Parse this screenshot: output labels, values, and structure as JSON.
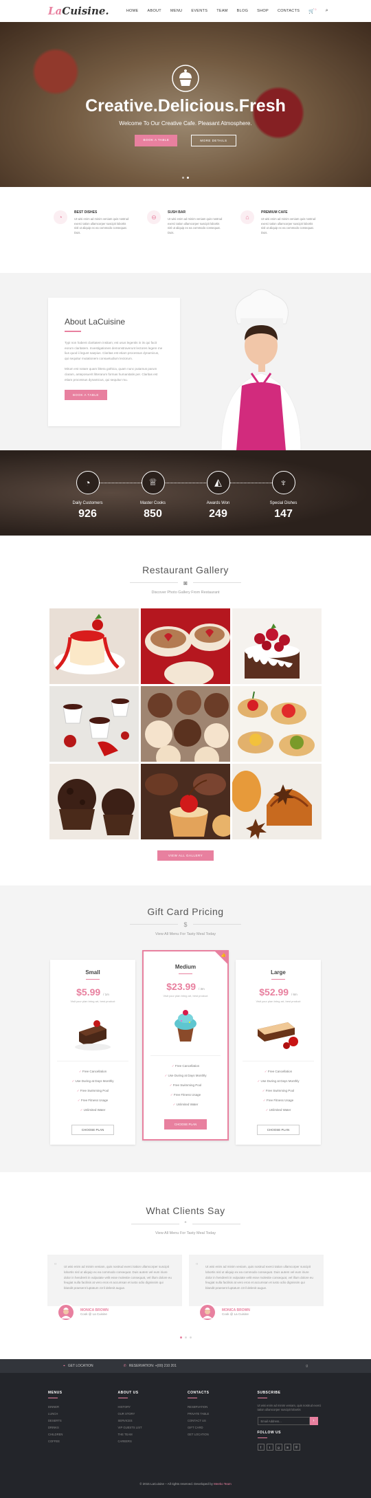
{
  "nav": {
    "logo_first": "La",
    "logo_rest": "Cuisine",
    "logo_dot": ".",
    "items": [
      "HOME",
      "ABOUT",
      "MENU",
      "EVENTS",
      "TEAM",
      "BLOG",
      "SHOP",
      "CONTACTS"
    ],
    "cart_count": "0"
  },
  "hero": {
    "title": "Creative.Delicious.Fresh",
    "subtitle": "Welcome To Our Creative Cafe. Pleasant Atmosphere.",
    "btn_primary": "BOOK A TABLE",
    "btn_secondary": "MORE DETAILS"
  },
  "features": [
    {
      "title": "BEST DISHES",
      "icon": "fish-icon",
      "text": "Ut wisi enim ad minim veniam quis nostrud exerci tation ullamcorper suscipit lobortis nisl ut aliquip ex ea commodo consequat. Duis."
    },
    {
      "title": "SUSH BAR",
      "icon": "sushi-icon",
      "text": "Ut wisi enim ad minim veniam quis nostrud exerci tation ullamcorper suscipit lobortis nisl ut aliquip ex ea commodo consequat. Duis."
    },
    {
      "title": "PREMIUM CAFE",
      "icon": "cake-icon",
      "text": "Ut wisi enim ad minim veniam quis nostrud exerci tation ullamcorper suscipit lobortis nisl ut aliquip ex ea commodo consequat. Duis."
    }
  ],
  "about": {
    "title": "About LaCuisine",
    "p1": "Typi non habent claritatem insitam; est usus legentis in iis qui facit eorum claritatem. Investigationes demonstraverunt lectores legere me lius quod ii legunt saepius. Claritas est etiam processus dynamicus, qui sequitur mutationem consuetudium lectorum.",
    "p2": "Mirum est notare quam littera gothica, quam nunc putamus parum claram, anteposuerit litterarum formas humanitatis per. Claritas est etiam processus dynamicus, qui sequitur mu.",
    "button": "BOOK A TABLE"
  },
  "counters": [
    {
      "label": "Daily Customers",
      "value": "926",
      "icon": "fish-icon",
      "glyph": "🐟"
    },
    {
      "label": "Master Cooks",
      "value": "850",
      "icon": "chef-hat-icon",
      "glyph": "👨‍🍳"
    },
    {
      "label": "Awards Won",
      "value": "249",
      "icon": "cheese-icon",
      "glyph": "🧀"
    },
    {
      "label": "Special Dishes",
      "value": "147",
      "icon": "wine-glass-icon",
      "glyph": "🍷"
    }
  ],
  "gallery": {
    "title": "Restaurant Gallery",
    "subtitle": "Discover Photo Gallery From Restaurant",
    "button": "VIEW ALL GALLERY"
  },
  "pricing": {
    "title": "Gift Card Pricing",
    "icon": "$",
    "subtitle": "View All Menu For Tasty Meal Today",
    "plans": [
      {
        "name": "Small",
        "price": "$5.99",
        "per": "/ 1m",
        "desc": "Visit your plan bring art, best product",
        "features": [
          "Free Cancellation",
          "Use During at Days Monthly",
          "Free Swimming Pool",
          "Free Fitness Usage",
          "Unlimited Water"
        ],
        "button": "CHOOSE PLAN"
      },
      {
        "name": "Medium",
        "price": "$23.99",
        "per": "/ 3m",
        "desc": "Visit your plan bring art, best product",
        "features": [
          "Free Cancellation",
          "Use During at Days Monthly",
          "Free Swimming Pool",
          "Free Fitness Usage",
          "Unlimited Water"
        ],
        "button": "CHOOSE PLAN"
      },
      {
        "name": "Large",
        "price": "$52.99",
        "per": "/ 6m",
        "desc": "Visit your plan bring art, best product",
        "features": [
          "Free Cancellation",
          "Use During at Days Monthly",
          "Free Swimming Pool",
          "Free Fitness Usage",
          "Unlimited Water"
        ],
        "button": "CHOOSE PLAN"
      }
    ]
  },
  "testimonials": {
    "title": "What Clients Say",
    "icon": "“",
    "subtitle": "View All Menu For Tasty Meal Today",
    "items": [
      {
        "text": "Ut wisi enim ad minim veniam, quis nostrud exerci tation ullamcorper suscipit lobortis nisl ut aliquip ex ea commodo consequat. Duis autem vel eum iriure dolor in hendrerit in vulputate velit esse molestie consequat, vel illum dolore eu feugiat nulla facilisis at vero eros et accumsan et iusto odio dignissim qui blandit praesent luptatum zzril delenit augue.",
        "name": "MONICA BROWN",
        "role": "Cook @ La Cuisine"
      },
      {
        "text": "Ut wisi enim ad minim veniam, quis nostrud exerci tation ullamcorper suscipit lobortis nisl ut aliquip ex ea commodo consequat. Duis autem vel eum iriure dolor in hendrerit in vulputate velit esse molestie consequat, vel illum dolore eu feugiat nulla facilisis at vero eros et accumsan et iusto odio dignissim qui blandit praesent luptatum zzril delenit augue.",
        "name": "MONICA BROWN",
        "role": "Cook @ La Cuisine"
      }
    ]
  },
  "footer_top": {
    "location": "GET LOCATION",
    "reservation": "RESERVATION: +(00) 210 201"
  },
  "footer": {
    "menus": {
      "title": "MENUS",
      "items": [
        "DINNER",
        "LUNCH",
        "DESERTS",
        "DRINKS",
        "CHILDREN",
        "COFFEE"
      ]
    },
    "about": {
      "title": "ABOUT US",
      "items": [
        "HISTORY",
        "OUR STORY",
        "SERVICES",
        "VIP GUESTS LIST",
        "THE TEAM",
        "CAREERS"
      ]
    },
    "contacts": {
      "title": "CONTACTS",
      "items": [
        "RESERVATION",
        "PRIVATE TABLE",
        "CONTACT US",
        "GIFT CARD",
        "GET LOCATION"
      ]
    },
    "subscribe": {
      "title": "SUBSCRIBE",
      "text": "Ut wisi enim ad minim veniam, quis nostrud exerci tation ullamcorper suscipit lobortis",
      "placeholder": "Email Address...",
      "follow": "FOLLOW US"
    },
    "copyright": "© 2015 LaCuisine – All rights reserved. Developed by",
    "credit": "Meeko Team"
  }
}
